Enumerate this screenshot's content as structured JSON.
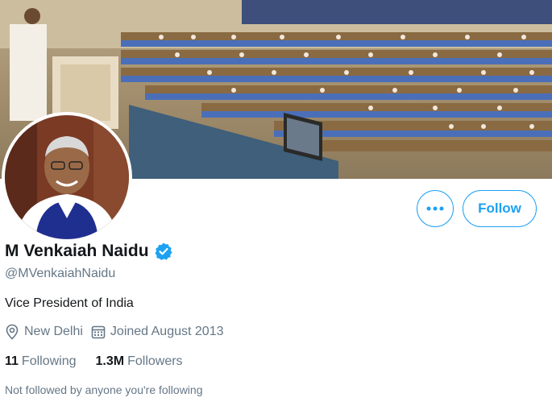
{
  "profile": {
    "name": "M Venkaiah Naidu",
    "handle": "@MVenkaiahNaidu",
    "bio": "Vice President of India",
    "location": "New Delhi",
    "joined": "Joined August 2013",
    "following_count": "11",
    "following_label": "Following",
    "followers_count": "1.3M",
    "followers_label": "Followers",
    "followed_note": "Not followed by anyone you're following"
  },
  "actions": {
    "more_label": "•••",
    "follow_label": "Follow"
  },
  "icons": {
    "location": "location-pin-icon",
    "calendar": "calendar-icon",
    "verified": "verified-badge-icon",
    "more": "more-options-icon"
  },
  "colors": {
    "accent": "#1da1f2",
    "secondary_text": "#657786",
    "primary_text": "#14171a"
  }
}
